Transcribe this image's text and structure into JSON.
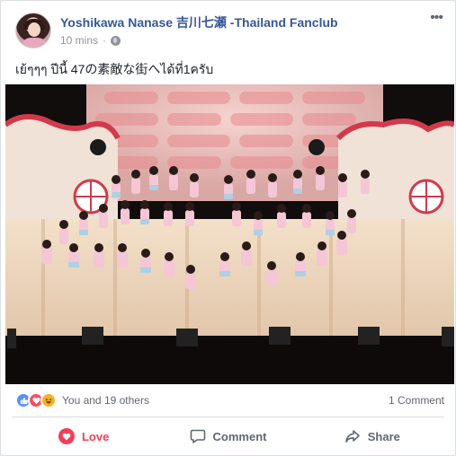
{
  "post": {
    "author": "Yoshikawa Nanase 吉川七瀬 -Thailand Fanclub",
    "timestamp": "10 mins",
    "audience_icon": "globe-icon",
    "text": "เย้ๆๆๆ ปีนี้ 47の素敵な街へได้ที่1ครับ"
  },
  "reactions": {
    "icons": [
      "like-icon",
      "love-icon",
      "haha-icon"
    ],
    "summary": "You and 19 others",
    "comments": "1 Comment"
  },
  "actions": {
    "love": "Love",
    "comment": "Comment",
    "share": "Share"
  },
  "colors": {
    "author_link": "#365899",
    "love_active": "#f33e58",
    "like": "#5890ff",
    "haha": "#f7b125"
  }
}
